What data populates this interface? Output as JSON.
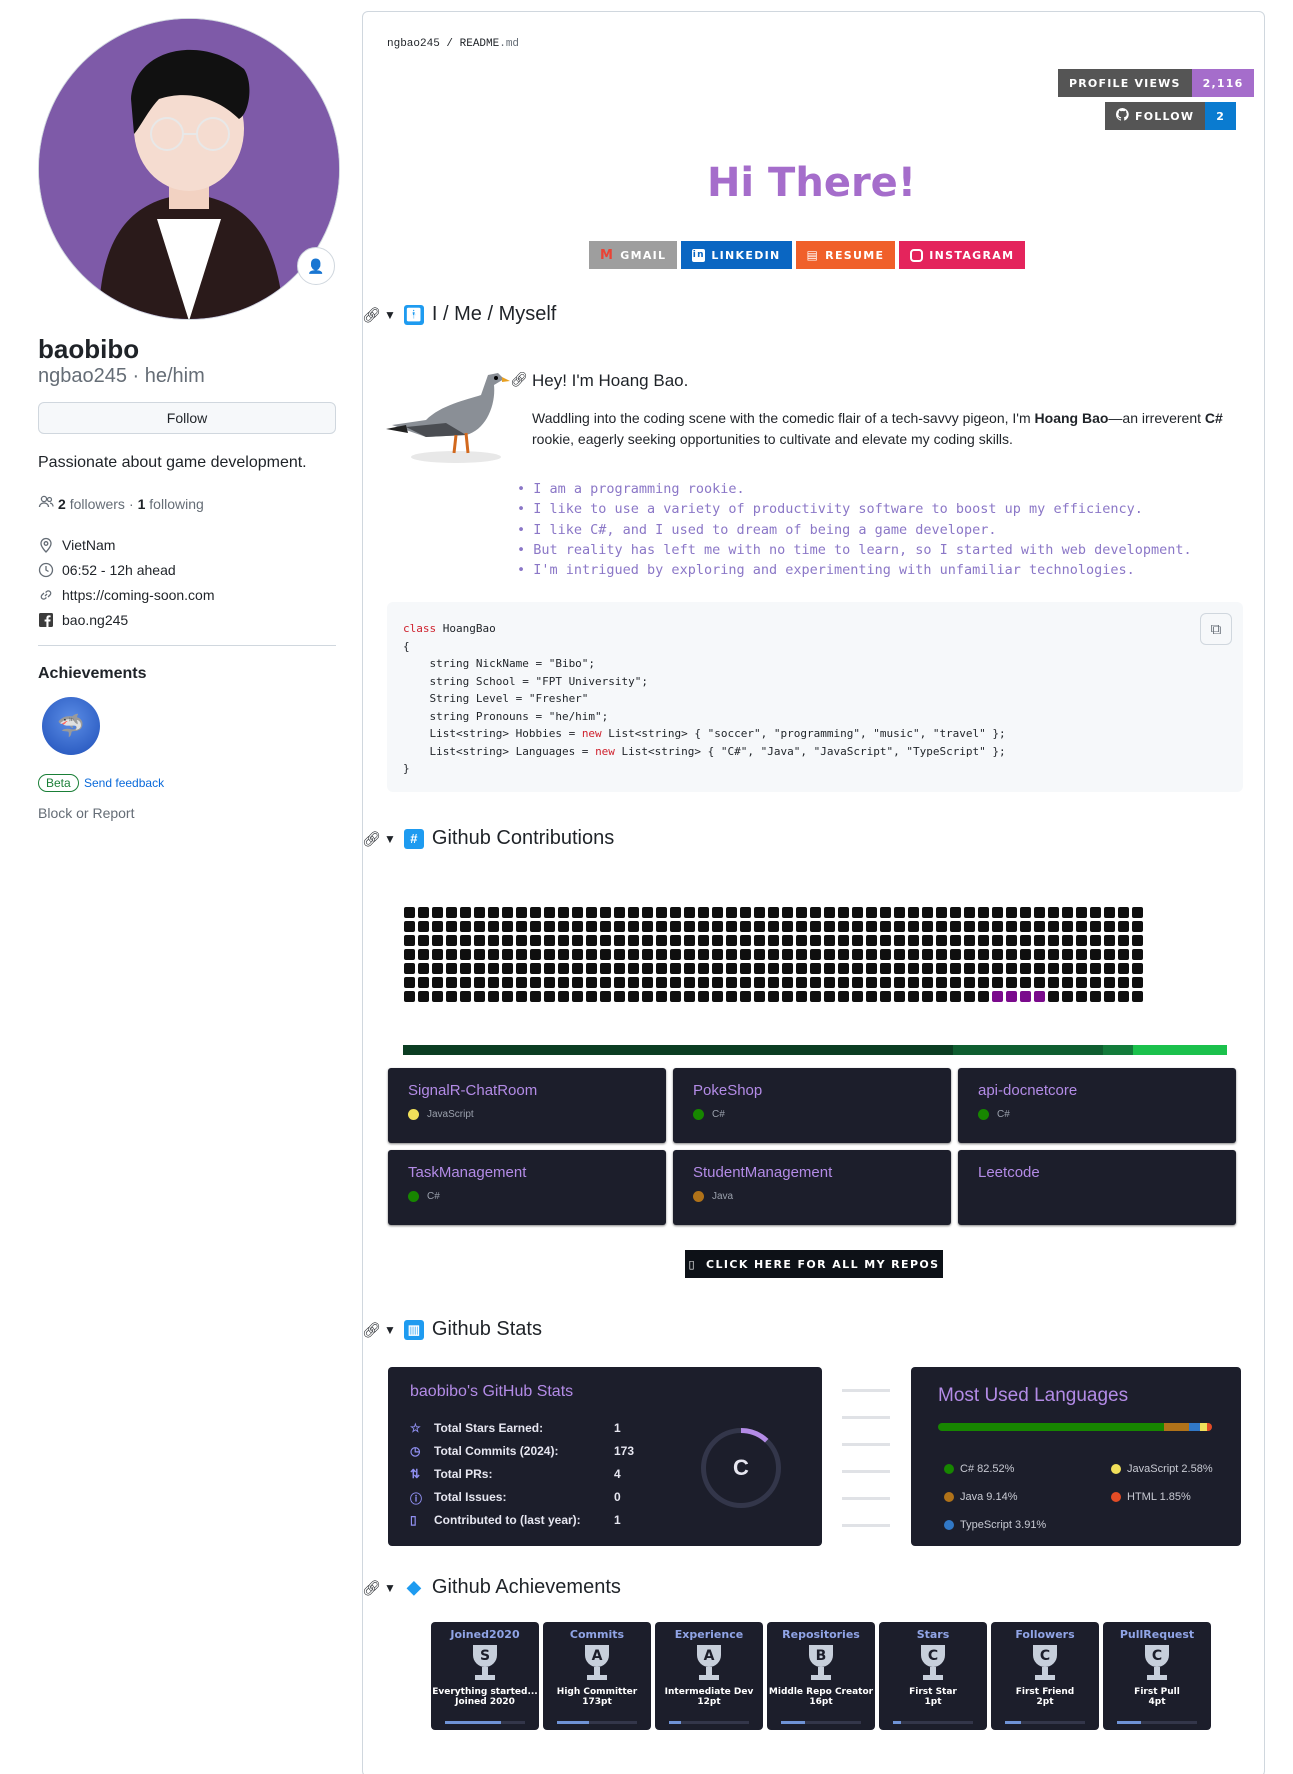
{
  "sidebar": {
    "display_name": "baobibo",
    "login_line": "ngbao245 · he/him",
    "follow_label": "Follow",
    "bio": "Passionate about game development.",
    "followers_count": "2",
    "followers_label": "followers",
    "following_sep": "·",
    "following_count": "1",
    "following_label": "following",
    "location": "VietNam",
    "local_time": "06:52 - 12h ahead",
    "website": "https://coming-soon.com",
    "facebook": "bao.ng245",
    "achievements_title": "Achievements",
    "beta_label": "Beta",
    "feedback_label": "Send feedback",
    "block_label": "Block or Report"
  },
  "readme": {
    "breadcrumb_user": "ngbao245",
    "breadcrumb_sep": " / ",
    "breadcrumb_file": "README",
    "breadcrumb_ext": ".md",
    "profile_views_label": "PROFILE VIEWS",
    "profile_views_value": "2,116",
    "follow_badge_label": "FOLLOW",
    "follow_badge_value": "2",
    "greeting": "Hi There!",
    "badges": [
      {
        "label": "GMAIL",
        "color": "#9e9e9e",
        "icon": "gmail-icon"
      },
      {
        "label": "LINKEDIN",
        "color": "#0a66c2",
        "icon": "linkedin-icon"
      },
      {
        "label": "RESUME",
        "color": "#f0602a",
        "icon": "resume-icon"
      },
      {
        "label": "INSTAGRAM",
        "color": "#e4245c",
        "icon": "instagram-icon"
      }
    ],
    "section_me": "I / Me / Myself",
    "hey": "Hey! I'm Hoang Bao.",
    "intro_pre": "Waddling into the coding scene with the comedic flair of a tech-savvy pigeon, I'm ",
    "intro_name": "Hoang Bao",
    "intro_mid": "—an irreverent ",
    "intro_lang": "C#",
    "intro_post": " rookie, eagerly seeking opportunities to cultivate and elevate my coding skills.",
    "bullets": [
      "I am a programming rookie.",
      "I like to use a variety of productivity software to boost up my efficiency.",
      "I like C#, and I used to dream of being a game developer.",
      "But reality has left me with no time to learn, so I started with web development.",
      "I'm intrigued by exploring and experimenting with unfamiliar technologies."
    ],
    "code": {
      "l1_kw": "class",
      "l1_rest": " HoangBao",
      "l2": "{",
      "l3": "    string NickName = \"Bibo\";",
      "l4": "    string School = \"FPT University\";",
      "l5": "    String Level = \"Fresher\"",
      "l6": "    string Pronouns = \"he/him\";",
      "l7_a": "    List<string> Hobbies = ",
      "l7_kw": "new",
      "l7_b": " List<string> { \"soccer\", \"programming\", \"music\", \"travel\" };",
      "l8_a": "    List<string> Languages = ",
      "l8_kw": "new",
      "l8_b": " List<string> { \"C#\", \"Java\", \"JavaScript\", \"TypeScript\" };",
      "l9": "}"
    },
    "section_contrib": "Github Contributions",
    "repos": [
      {
        "name": "SignalR-ChatRoom",
        "lang": "JavaScript",
        "color": "#f1e05a"
      },
      {
        "name": "PokeShop",
        "lang": "C#",
        "color": "#178600"
      },
      {
        "name": "api-docnetcore",
        "lang": "C#",
        "color": "#178600"
      },
      {
        "name": "TaskManagement",
        "lang": "C#",
        "color": "#178600"
      },
      {
        "name": "StudentManagement",
        "lang": "Java",
        "color": "#b07219"
      },
      {
        "name": "Leetcode",
        "lang": "",
        "color": ""
      }
    ],
    "all_repos_label": "CLICK HERE FOR ALL MY REPOS",
    "section_stats": "Github Stats",
    "stats_title": "baobibo's GitHub Stats",
    "stats": [
      {
        "label": "Total Stars Earned:",
        "value": "1",
        "icon": "star-icon"
      },
      {
        "label": "Total Commits (2024):",
        "value": "173",
        "icon": "history-icon"
      },
      {
        "label": "Total PRs:",
        "value": "4",
        "icon": "pull-request-icon"
      },
      {
        "label": "Total Issues:",
        "value": "0",
        "icon": "issue-icon"
      },
      {
        "label": "Contributed to (last year):",
        "value": "1",
        "icon": "repo-icon"
      }
    ],
    "rank": "C",
    "rank_progress": 0.12,
    "langs_title": "Most Used Languages",
    "langs": [
      {
        "name": "C# 82.52%",
        "pct": 82.52,
        "color": "#178600"
      },
      {
        "name": "Java 9.14%",
        "pct": 9.14,
        "color": "#b07219"
      },
      {
        "name": "TypeScript 3.91%",
        "pct": 3.91,
        "color": "#3178c6"
      },
      {
        "name": "JavaScript 2.58%",
        "pct": 2.58,
        "color": "#f1e05a"
      },
      {
        "name": "HTML 1.85%",
        "pct": 1.85,
        "color": "#e34c26"
      }
    ],
    "section_achievements": "Github Achievements",
    "trophies": [
      {
        "title": "Joined2020",
        "rank": "S",
        "sub": "Everything started...",
        "pts": "Joined 2020",
        "progress": 0.7
      },
      {
        "title": "Commits",
        "rank": "A",
        "sub": "High Committer",
        "pts": "173pt",
        "progress": 0.4
      },
      {
        "title": "Experience",
        "rank": "A",
        "sub": "Intermediate Dev",
        "pts": "12pt",
        "progress": 0.15
      },
      {
        "title": "Repositories",
        "rank": "B",
        "sub": "Middle Repo Creator",
        "pts": "16pt",
        "progress": 0.3
      },
      {
        "title": "Stars",
        "rank": "C",
        "sub": "First Star",
        "pts": "1pt",
        "progress": 0.1
      },
      {
        "title": "Followers",
        "rank": "C",
        "sub": "First Friend",
        "pts": "2pt",
        "progress": 0.2
      },
      {
        "title": "PullRequest",
        "rank": "C",
        "sub": "First Pull",
        "pts": "4pt",
        "progress": 0.3
      }
    ]
  }
}
